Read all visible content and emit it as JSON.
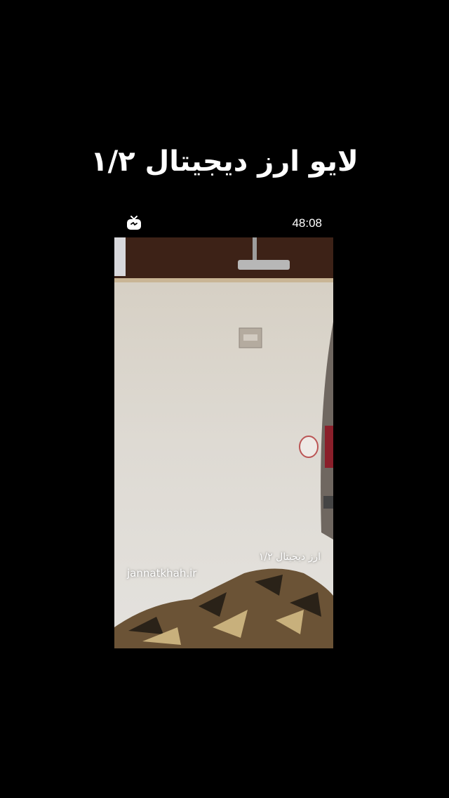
{
  "title": "لایو ارز دیجیتال ۱/۲",
  "player": {
    "icon": "igtv-icon",
    "timer": "48:08"
  },
  "video": {
    "watermark": "jannatkhah.ir",
    "caption": "ارز دیجیتال ۱/۲"
  },
  "colors": {
    "background": "#000000",
    "text": "#ffffff"
  }
}
